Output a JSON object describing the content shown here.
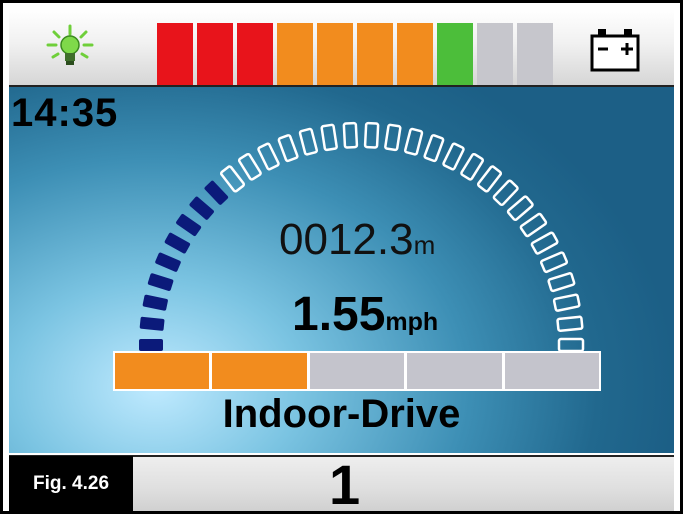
{
  "status_bar": {
    "lamp_icon": "lamp-on-icon",
    "battery_icon": "battery-icon",
    "battery_gauge": {
      "segments": [
        {
          "color": "#e8141b"
        },
        {
          "color": "#e8141b"
        },
        {
          "color": "#e8141b"
        },
        {
          "color": "#f28c1e"
        },
        {
          "color": "#f28c1e"
        },
        {
          "color": "#f28c1e"
        },
        {
          "color": "#f28c1e"
        },
        {
          "color": "#4cbe3a"
        },
        {
          "color": "#c6c6cc"
        },
        {
          "color": "#c6c6cc"
        }
      ],
      "filled_segments": 8,
      "total_segments": 10
    }
  },
  "main": {
    "clock": "14:35",
    "distance": {
      "value": "0012.3",
      "unit": "m"
    },
    "speed": {
      "value": "1.55",
      "unit": "mph"
    },
    "speedometer": {
      "total_ticks": 32,
      "lit_ticks": 9,
      "lit_color": "#0b1a7a",
      "unlit_color": "#ffffff"
    },
    "speed_setting": {
      "segments": 5,
      "active_segments": 2,
      "active_color": "#f28c1e",
      "inactive_color": "#c4c4cc"
    },
    "profile_name": "Indoor-Drive"
  },
  "bottom_bar": {
    "profile_number": "1",
    "figure_label": "Fig. 4.26"
  }
}
